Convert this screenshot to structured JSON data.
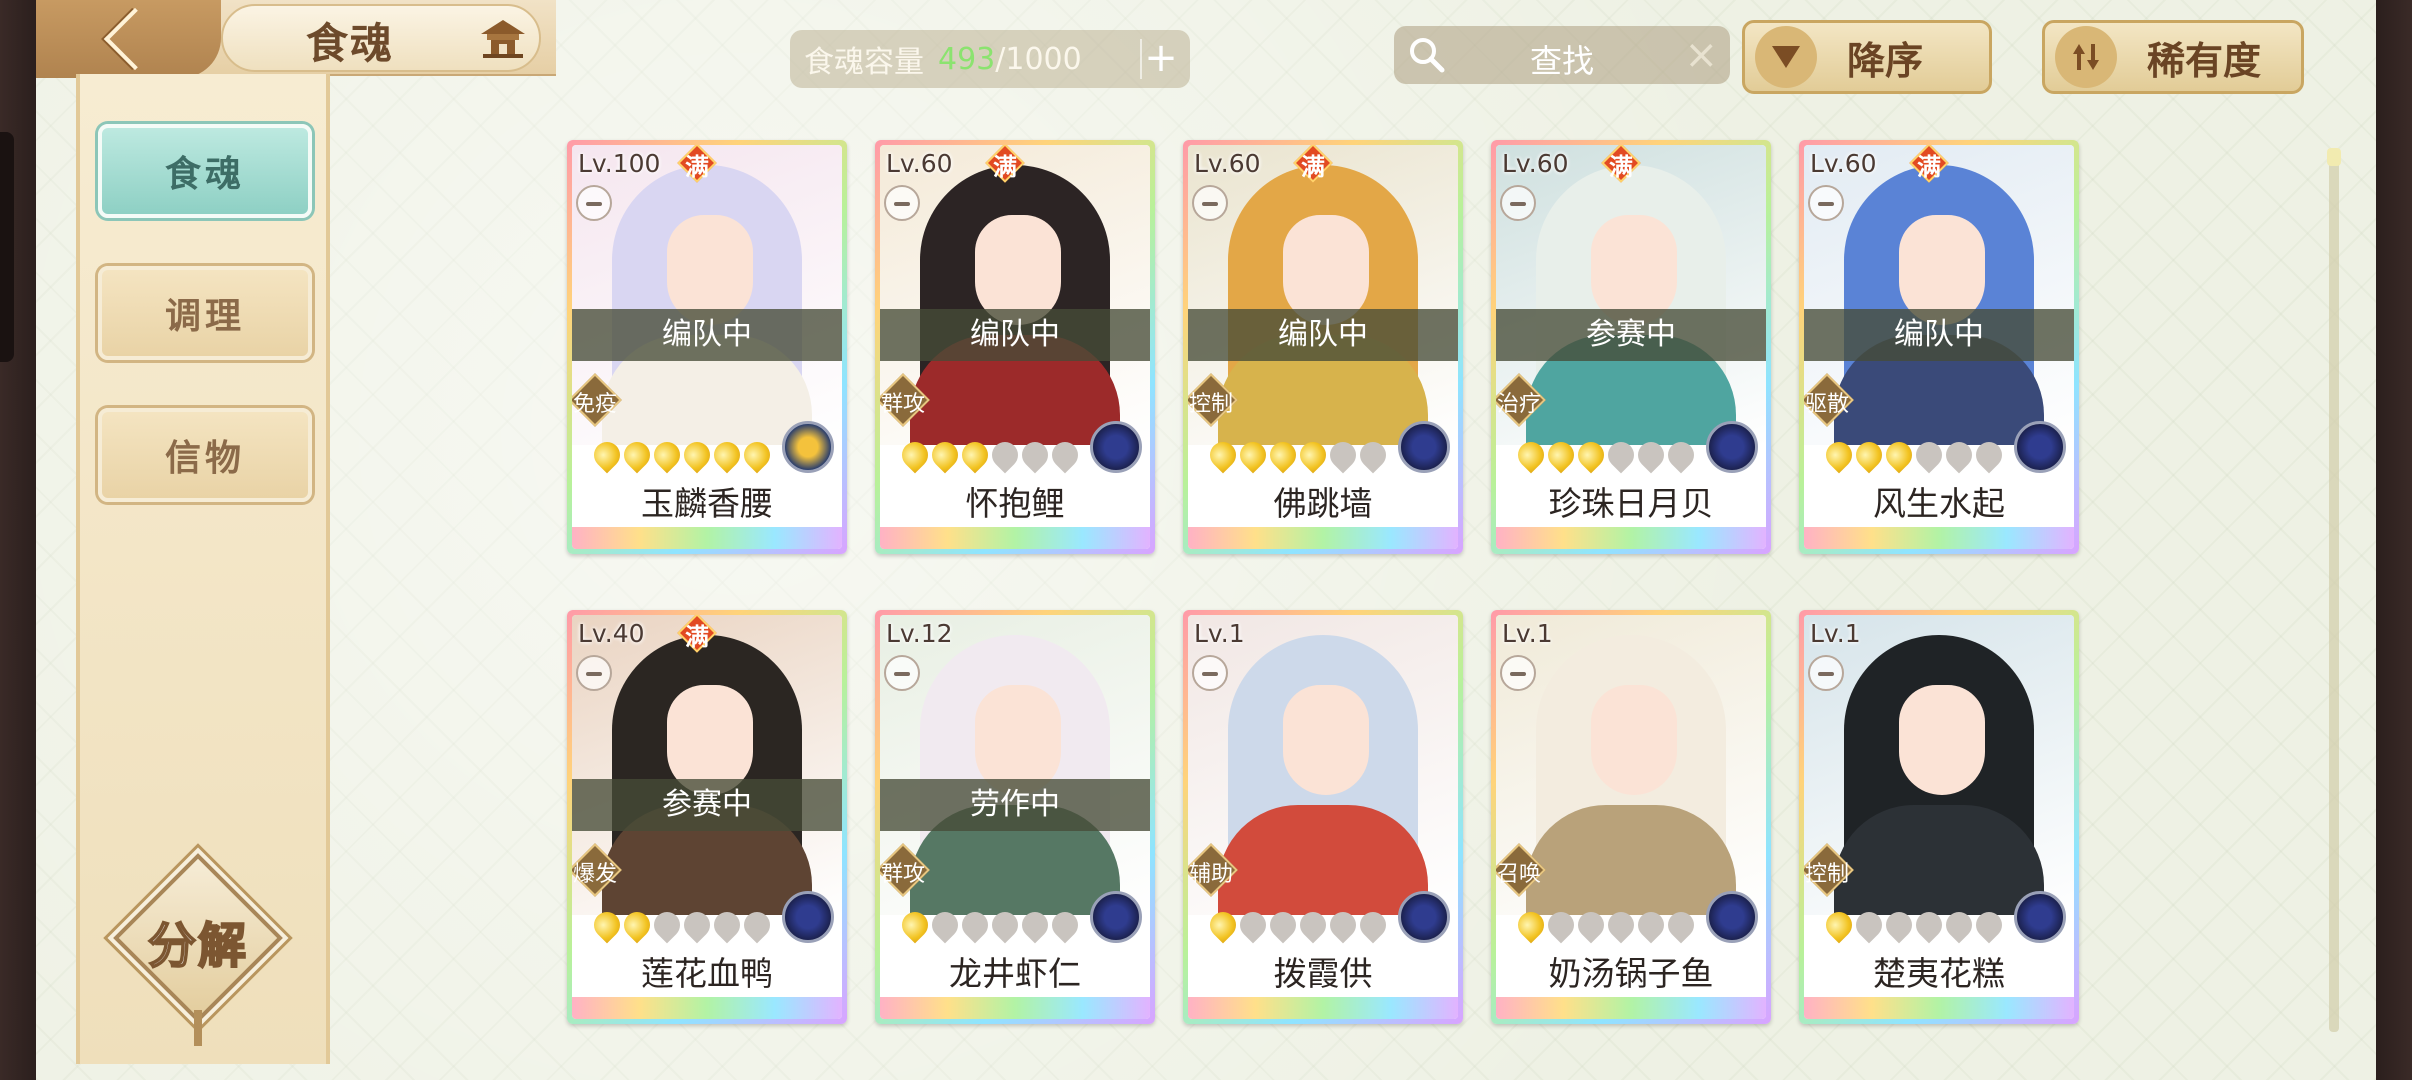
{
  "header": {
    "title": "食魂",
    "capacity": {
      "label": "食魂容量",
      "current": "493",
      "max": "/1000",
      "add": "+"
    },
    "search": {
      "placeholder": "查找",
      "clear": "×"
    },
    "sort_desc_label": "降序",
    "sort_rarity_label": "稀有度"
  },
  "sidebar": {
    "items": [
      {
        "label": "食魂",
        "active": true
      },
      {
        "label": "调理",
        "active": false
      },
      {
        "label": "信物",
        "active": false
      }
    ],
    "decompose_label": "分解"
  },
  "full_badge": "满",
  "cards": [
    {
      "level": "Lv.100",
      "full": true,
      "status": "编队中",
      "role": "免疫",
      "stars": 6,
      "name": "玉麟香腰",
      "hair": "#d9d6f2",
      "robe": "#f4efe6",
      "bg": "#f5e6ef",
      "elem": "gold"
    },
    {
      "level": "Lv.60",
      "full": true,
      "status": "编队中",
      "role": "群攻",
      "stars": 3,
      "name": "怀抱鲤",
      "hair": "#2c2424",
      "robe": "#9c2a2a",
      "bg": "#f4ead8",
      "elem": "blue"
    },
    {
      "level": "Lv.60",
      "full": true,
      "status": "编队中",
      "role": "控制",
      "stars": 4,
      "name": "佛跳墙",
      "hair": "#e3a747",
      "robe": "#d7b34c",
      "bg": "#eae4cf",
      "elem": "blue"
    },
    {
      "level": "Lv.60",
      "full": true,
      "status": "参赛中",
      "role": "治疗",
      "stars": 3,
      "name": "珍珠日月贝",
      "hair": "#e8efea",
      "robe": "#4fa5a0",
      "bg": "#cfe0df",
      "elem": "blue"
    },
    {
      "level": "Lv.60",
      "full": true,
      "status": "编队中",
      "role": "驱散",
      "stars": 3,
      "name": "风生水起",
      "hair": "#5a83d6",
      "robe": "#3a4a79",
      "bg": "#e2ebf3",
      "elem": "blue"
    },
    {
      "level": "Lv.40",
      "full": true,
      "status": "参赛中",
      "role": "爆发",
      "stars": 2,
      "name": "莲花血鸭",
      "hair": "#2b2622",
      "robe": "#5e4433",
      "bg": "#ead4c2",
      "elem": "blue"
    },
    {
      "level": "Lv.12",
      "full": false,
      "status": "劳作中",
      "role": "群攻",
      "stars": 1,
      "name": "龙井虾仁",
      "hair": "#f1eaf0",
      "robe": "#567864",
      "bg": "#e8efe3",
      "elem": "blue"
    },
    {
      "level": "Lv.1",
      "full": false,
      "status": "",
      "role": "辅助",
      "stars": 1,
      "name": "拨霞供",
      "hair": "#cdd9ea",
      "robe": "#d24b3c",
      "bg": "#f1e7e4",
      "elem": "blue"
    },
    {
      "level": "Lv.1",
      "full": false,
      "status": "",
      "role": "召唤",
      "stars": 1,
      "name": "奶汤锅子鱼",
      "hair": "#f3ecdf",
      "robe": "#b9a27a",
      "bg": "#f0ead8",
      "elem": "blue"
    },
    {
      "level": "Lv.1",
      "full": false,
      "status": "",
      "role": "控制",
      "stars": 1,
      "name": "楚夷花糕",
      "hair": "#1f2326",
      "robe": "#2c3136",
      "bg": "#d6e4ea",
      "elem": "blue"
    }
  ]
}
